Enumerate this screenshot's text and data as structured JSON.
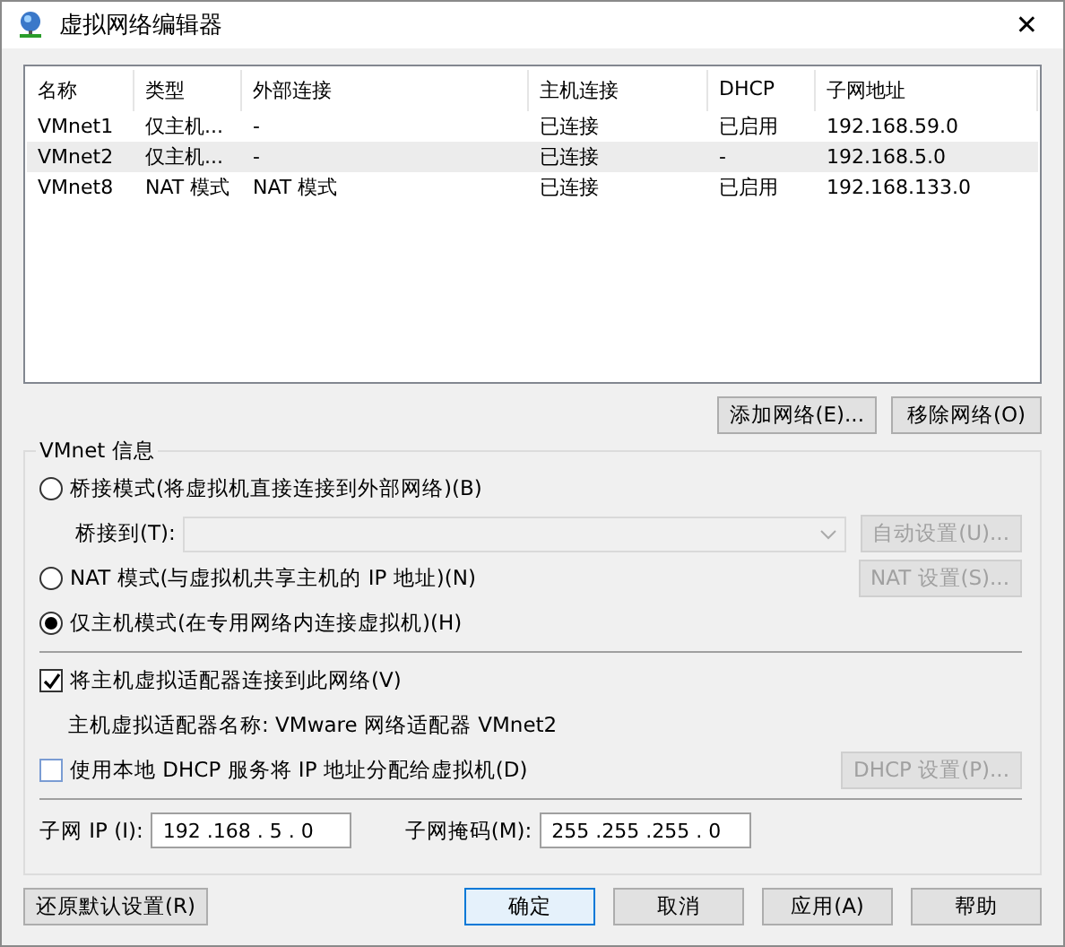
{
  "window": {
    "title": "虚拟网络编辑器",
    "close": "✕"
  },
  "table": {
    "columns": [
      "名称",
      "类型",
      "外部连接",
      "主机连接",
      "DHCP",
      "子网地址"
    ],
    "rows": [
      {
        "cells": [
          "VMnet1",
          "仅主机...",
          "-",
          "已连接",
          "已启用",
          "192.168.59.0"
        ],
        "selected": false
      },
      {
        "cells": [
          "VMnet2",
          "仅主机...",
          "-",
          "已连接",
          "-",
          "192.168.5.0"
        ],
        "selected": true
      },
      {
        "cells": [
          "VMnet8",
          "NAT 模式",
          "NAT 模式",
          "已连接",
          "已启用",
          "192.168.133.0"
        ],
        "selected": false
      }
    ]
  },
  "list_buttons": [
    {
      "label": "添加网络(E)...",
      "disabled": false
    },
    {
      "label": "移除网络(O)",
      "disabled": false
    }
  ],
  "vmnet_info": {
    "title": "VMnet 信息",
    "modes": [
      {
        "label": "桥接模式(将虚拟机直接连接到外部网络)(B)",
        "selected": false
      },
      {
        "label": "NAT 模式(与虚拟机共享主机的 IP 地址)(N)",
        "selected": false
      },
      {
        "label": "仅主机模式(在专用网络内连接虚拟机)(H)",
        "selected": true
      }
    ],
    "bridge_to": {
      "label": "桥接到(T):",
      "disabled": true
    },
    "auto_button": {
      "label": "自动设置(U)...",
      "disabled": true
    },
    "nat_button": {
      "label": "NAT 设置(S)...",
      "disabled": true
    },
    "connect_adapter": {
      "label": "将主机虚拟适配器连接到此网络(V)",
      "checked": true
    },
    "adapter_name": "主机虚拟适配器名称: VMware 网络适配器 VMnet2",
    "use_dhcp": {
      "label": "使用本地 DHCP 服务将 IP 地址分配给虚拟机(D)",
      "checked": false
    },
    "dhcp_button": {
      "label": "DHCP 设置(P)...",
      "disabled": true
    },
    "subnet_ip": {
      "label": "子网 IP (I):",
      "value": "192 .168 . 5 . 0"
    },
    "subnet_mask": {
      "label": "子网掩码(M):",
      "value": "255 .255 .255 . 0"
    }
  },
  "footer_buttons": [
    {
      "label": "还原默认设置(R)",
      "primary": false
    },
    {
      "label": "确定",
      "primary": true
    },
    {
      "label": "取消",
      "primary": false
    },
    {
      "label": "应用(A)",
      "primary": false
    },
    {
      "label": "帮助",
      "primary": false
    }
  ]
}
